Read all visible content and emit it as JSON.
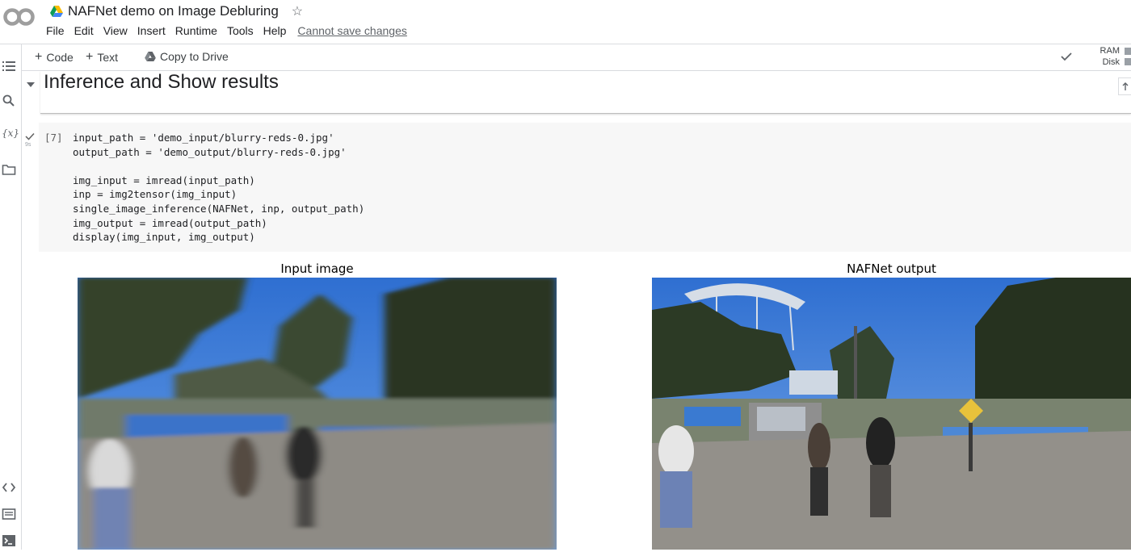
{
  "app": {
    "document_title": "NAFNet demo on Image Debluring",
    "menu": [
      "File",
      "Edit",
      "View",
      "Insert",
      "Runtime",
      "Tools",
      "Help"
    ],
    "save_status": "Cannot save changes"
  },
  "toolbar": {
    "add_code_label": "Code",
    "add_text_label": "Text",
    "copy_to_drive_label": "Copy to Drive",
    "ram_label": "RAM",
    "disk_label": "Disk",
    "ram_fill_fraction": 0.2,
    "disk_fill_fraction": 0.22
  },
  "text_cell": {
    "heading": "Inference and Show results"
  },
  "code_cell": {
    "execution_count": "[7]",
    "lines": [
      "input_path = 'demo_input/blurry-reds-0.jpg'",
      "output_path = 'demo_output/blurry-reds-0.jpg'",
      "",
      "img_input = imread(input_path)",
      "inp = img2tensor(img_input)",
      "single_image_inference(NAFNet, inp, output_path)",
      "img_output = imread(output_path)",
      "display(img_input, img_output)"
    ]
  },
  "output": {
    "left_title": "Input image",
    "right_title": "NAFNet output"
  },
  "colors": {
    "sky": "#3f7fd8",
    "road": "#8d8a82",
    "trees": "#2f3a28"
  }
}
